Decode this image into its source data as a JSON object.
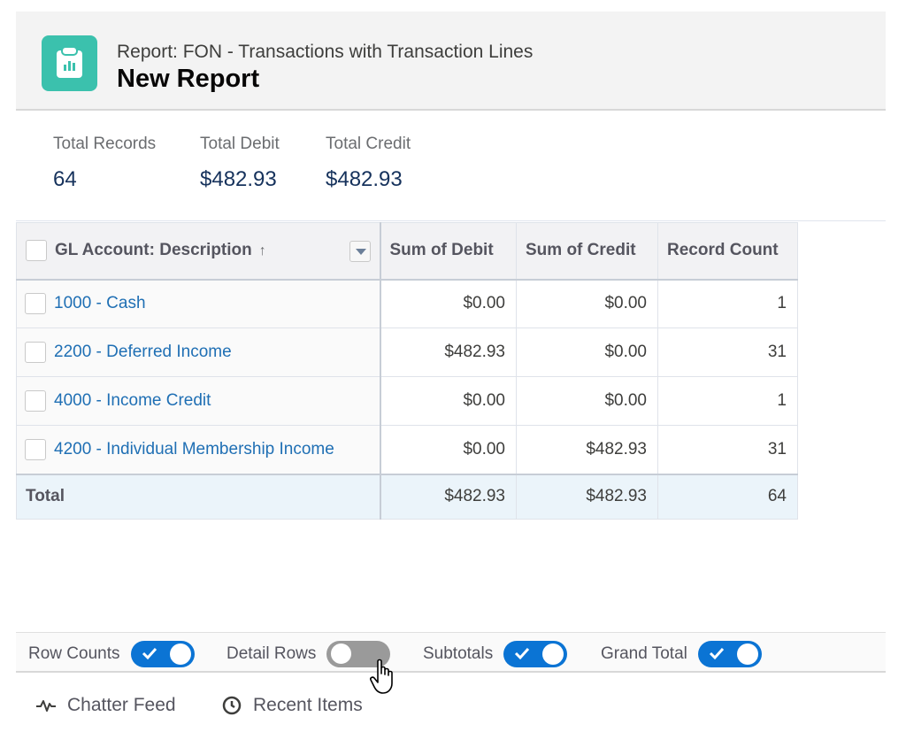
{
  "header": {
    "subtitle": "Report: FON - Transactions with Transaction Lines",
    "title": "New Report",
    "icon": "report-clipboard-icon",
    "icon_color": "#3bc1ad"
  },
  "summary": [
    {
      "label": "Total Records",
      "value": "64"
    },
    {
      "label": "Total Debit",
      "value": "$482.93"
    },
    {
      "label": "Total Credit",
      "value": "$482.93"
    }
  ],
  "table": {
    "columns": [
      {
        "label": "GL Account: Description",
        "sort": "ascending",
        "sort_icon": "arrow-up-icon"
      },
      {
        "label": "Sum of Debit"
      },
      {
        "label": "Sum of Credit"
      },
      {
        "label": "Record Count"
      }
    ],
    "rows": [
      {
        "account": "1000 - Cash",
        "debit": "$0.00",
        "credit": "$0.00",
        "count": "1"
      },
      {
        "account": "2200 - Deferred Income",
        "debit": "$482.93",
        "credit": "$0.00",
        "count": "31"
      },
      {
        "account": "4000 - Income Credit",
        "debit": "$0.00",
        "credit": "$0.00",
        "count": "1"
      },
      {
        "account": "4200 - Individual Membership Income",
        "debit": "$0.00",
        "credit": "$482.93",
        "count": "31"
      }
    ],
    "total": {
      "label": "Total",
      "debit": "$482.93",
      "credit": "$482.93",
      "count": "64"
    }
  },
  "toolbar": {
    "toggles": [
      {
        "label": "Row Counts",
        "on": true
      },
      {
        "label": "Detail Rows",
        "on": false
      },
      {
        "label": "Subtotals",
        "on": true
      },
      {
        "label": "Grand Total",
        "on": true
      }
    ],
    "toggle_on_color": "#0b74d4",
    "toggle_off_color": "#9a9a9a"
  },
  "footer": {
    "chatter": {
      "label": "Chatter Feed",
      "icon": "pulse-icon"
    },
    "recent": {
      "label": "Recent Items",
      "icon": "clock-icon"
    }
  }
}
